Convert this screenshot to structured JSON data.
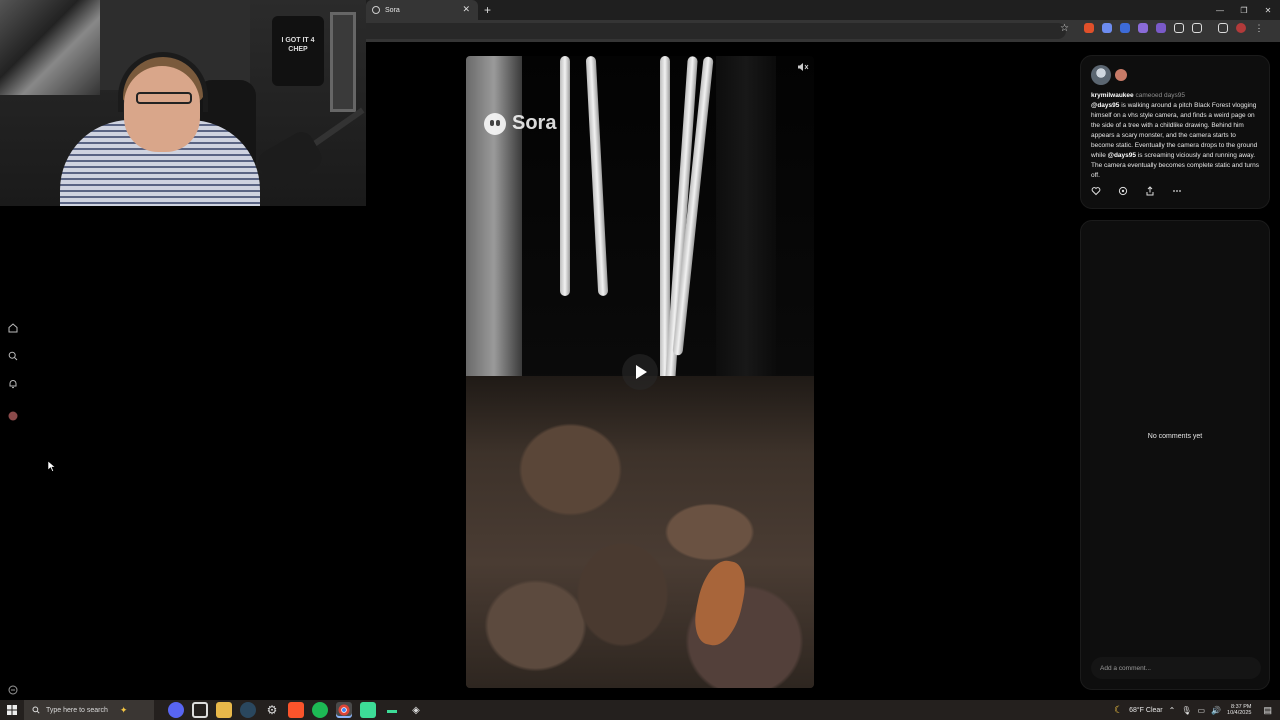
{
  "webcam": {
    "shirt_text": "I GOT IT 4 CHEP"
  },
  "browser": {
    "tab_title": "Sora",
    "new_tab": "+",
    "window_controls": [
      "—",
      "❐",
      "✕"
    ],
    "tab_close": "✕"
  },
  "video": {
    "watermark": "Sora"
  },
  "post": {
    "username": "krymilwaukee",
    "cameo_text": "cameoed days95",
    "mention": "@days95",
    "caption_1": " is walking around a pitch Black Forest vlogging himself on a vhs style camera, and finds a weird page on the side of a tree with a childlike drawing. Behind him appears a scary monster, and the camera starts to become static. Eventually the camera drops to the ground while ",
    "caption_2": " is screaming viciously and running away. The camera eventually becomes complete static and turns off."
  },
  "comments": {
    "empty_text": "No comments yet",
    "placeholder": "Add a comment..."
  },
  "taskbar": {
    "search_placeholder": "Type here to search",
    "weather": "68°F  Clear",
    "time": "8:37 PM",
    "date": "10/4/2025"
  },
  "colors": {
    "background": "#000000",
    "panel": "#0e0e0e",
    "tab_active": "#353535",
    "taskbar": "#24201e"
  }
}
